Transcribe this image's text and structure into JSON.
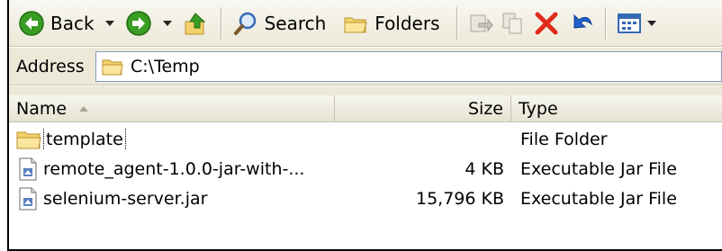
{
  "toolbar": {
    "back_label": "Back",
    "search_label": "Search",
    "folders_label": "Folders",
    "icons": [
      "back-icon",
      "forward-icon",
      "up-folder-icon",
      "search-icon",
      "folders-icon",
      "move-to-icon",
      "copy-to-icon",
      "delete-icon",
      "undo-icon",
      "views-icon"
    ]
  },
  "address": {
    "label": "Address",
    "path": "C:\\Temp"
  },
  "columns": {
    "name": "Name",
    "size": "Size",
    "type": "Type"
  },
  "files": [
    {
      "name": "template",
      "size": "",
      "type": "File Folder",
      "icon": "folder-icon"
    },
    {
      "name": "remote_agent-1.0.0-jar-with-...",
      "size": "4 KB",
      "type": "Executable Jar File",
      "icon": "jar-file-icon"
    },
    {
      "name": "selenium-server.jar",
      "size": "15,796 KB",
      "type": "Executable Jar File",
      "icon": "jar-file-icon"
    }
  ],
  "colors": {
    "toolbar_bg": "#ece9d8",
    "nav_green": "#3a9d23",
    "delete_red": "#e02a1a",
    "undo_blue": "#1f5fd0",
    "folder_yellow": "#f3d26b"
  }
}
